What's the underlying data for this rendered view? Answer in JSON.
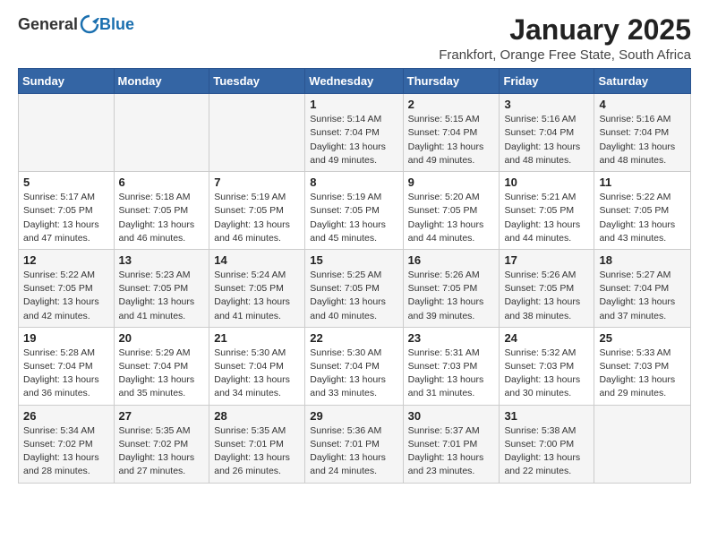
{
  "logo": {
    "general": "General",
    "blue": "Blue"
  },
  "header": {
    "month": "January 2025",
    "location": "Frankfort, Orange Free State, South Africa"
  },
  "weekdays": [
    "Sunday",
    "Monday",
    "Tuesday",
    "Wednesday",
    "Thursday",
    "Friday",
    "Saturday"
  ],
  "weeks": [
    [
      {
        "day": "",
        "info": ""
      },
      {
        "day": "",
        "info": ""
      },
      {
        "day": "",
        "info": ""
      },
      {
        "day": "1",
        "info": "Sunrise: 5:14 AM\nSunset: 7:04 PM\nDaylight: 13 hours\nand 49 minutes."
      },
      {
        "day": "2",
        "info": "Sunrise: 5:15 AM\nSunset: 7:04 PM\nDaylight: 13 hours\nand 49 minutes."
      },
      {
        "day": "3",
        "info": "Sunrise: 5:16 AM\nSunset: 7:04 PM\nDaylight: 13 hours\nand 48 minutes."
      },
      {
        "day": "4",
        "info": "Sunrise: 5:16 AM\nSunset: 7:04 PM\nDaylight: 13 hours\nand 48 minutes."
      }
    ],
    [
      {
        "day": "5",
        "info": "Sunrise: 5:17 AM\nSunset: 7:05 PM\nDaylight: 13 hours\nand 47 minutes."
      },
      {
        "day": "6",
        "info": "Sunrise: 5:18 AM\nSunset: 7:05 PM\nDaylight: 13 hours\nand 46 minutes."
      },
      {
        "day": "7",
        "info": "Sunrise: 5:19 AM\nSunset: 7:05 PM\nDaylight: 13 hours\nand 46 minutes."
      },
      {
        "day": "8",
        "info": "Sunrise: 5:19 AM\nSunset: 7:05 PM\nDaylight: 13 hours\nand 45 minutes."
      },
      {
        "day": "9",
        "info": "Sunrise: 5:20 AM\nSunset: 7:05 PM\nDaylight: 13 hours\nand 44 minutes."
      },
      {
        "day": "10",
        "info": "Sunrise: 5:21 AM\nSunset: 7:05 PM\nDaylight: 13 hours\nand 44 minutes."
      },
      {
        "day": "11",
        "info": "Sunrise: 5:22 AM\nSunset: 7:05 PM\nDaylight: 13 hours\nand 43 minutes."
      }
    ],
    [
      {
        "day": "12",
        "info": "Sunrise: 5:22 AM\nSunset: 7:05 PM\nDaylight: 13 hours\nand 42 minutes."
      },
      {
        "day": "13",
        "info": "Sunrise: 5:23 AM\nSunset: 7:05 PM\nDaylight: 13 hours\nand 41 minutes."
      },
      {
        "day": "14",
        "info": "Sunrise: 5:24 AM\nSunset: 7:05 PM\nDaylight: 13 hours\nand 41 minutes."
      },
      {
        "day": "15",
        "info": "Sunrise: 5:25 AM\nSunset: 7:05 PM\nDaylight: 13 hours\nand 40 minutes."
      },
      {
        "day": "16",
        "info": "Sunrise: 5:26 AM\nSunset: 7:05 PM\nDaylight: 13 hours\nand 39 minutes."
      },
      {
        "day": "17",
        "info": "Sunrise: 5:26 AM\nSunset: 7:05 PM\nDaylight: 13 hours\nand 38 minutes."
      },
      {
        "day": "18",
        "info": "Sunrise: 5:27 AM\nSunset: 7:04 PM\nDaylight: 13 hours\nand 37 minutes."
      }
    ],
    [
      {
        "day": "19",
        "info": "Sunrise: 5:28 AM\nSunset: 7:04 PM\nDaylight: 13 hours\nand 36 minutes."
      },
      {
        "day": "20",
        "info": "Sunrise: 5:29 AM\nSunset: 7:04 PM\nDaylight: 13 hours\nand 35 minutes."
      },
      {
        "day": "21",
        "info": "Sunrise: 5:30 AM\nSunset: 7:04 PM\nDaylight: 13 hours\nand 34 minutes."
      },
      {
        "day": "22",
        "info": "Sunrise: 5:30 AM\nSunset: 7:04 PM\nDaylight: 13 hours\nand 33 minutes."
      },
      {
        "day": "23",
        "info": "Sunrise: 5:31 AM\nSunset: 7:03 PM\nDaylight: 13 hours\nand 31 minutes."
      },
      {
        "day": "24",
        "info": "Sunrise: 5:32 AM\nSunset: 7:03 PM\nDaylight: 13 hours\nand 30 minutes."
      },
      {
        "day": "25",
        "info": "Sunrise: 5:33 AM\nSunset: 7:03 PM\nDaylight: 13 hours\nand 29 minutes."
      }
    ],
    [
      {
        "day": "26",
        "info": "Sunrise: 5:34 AM\nSunset: 7:02 PM\nDaylight: 13 hours\nand 28 minutes."
      },
      {
        "day": "27",
        "info": "Sunrise: 5:35 AM\nSunset: 7:02 PM\nDaylight: 13 hours\nand 27 minutes."
      },
      {
        "day": "28",
        "info": "Sunrise: 5:35 AM\nSunset: 7:01 PM\nDaylight: 13 hours\nand 26 minutes."
      },
      {
        "day": "29",
        "info": "Sunrise: 5:36 AM\nSunset: 7:01 PM\nDaylight: 13 hours\nand 24 minutes."
      },
      {
        "day": "30",
        "info": "Sunrise: 5:37 AM\nSunset: 7:01 PM\nDaylight: 13 hours\nand 23 minutes."
      },
      {
        "day": "31",
        "info": "Sunrise: 5:38 AM\nSunset: 7:00 PM\nDaylight: 13 hours\nand 22 minutes."
      },
      {
        "day": "",
        "info": ""
      }
    ]
  ]
}
